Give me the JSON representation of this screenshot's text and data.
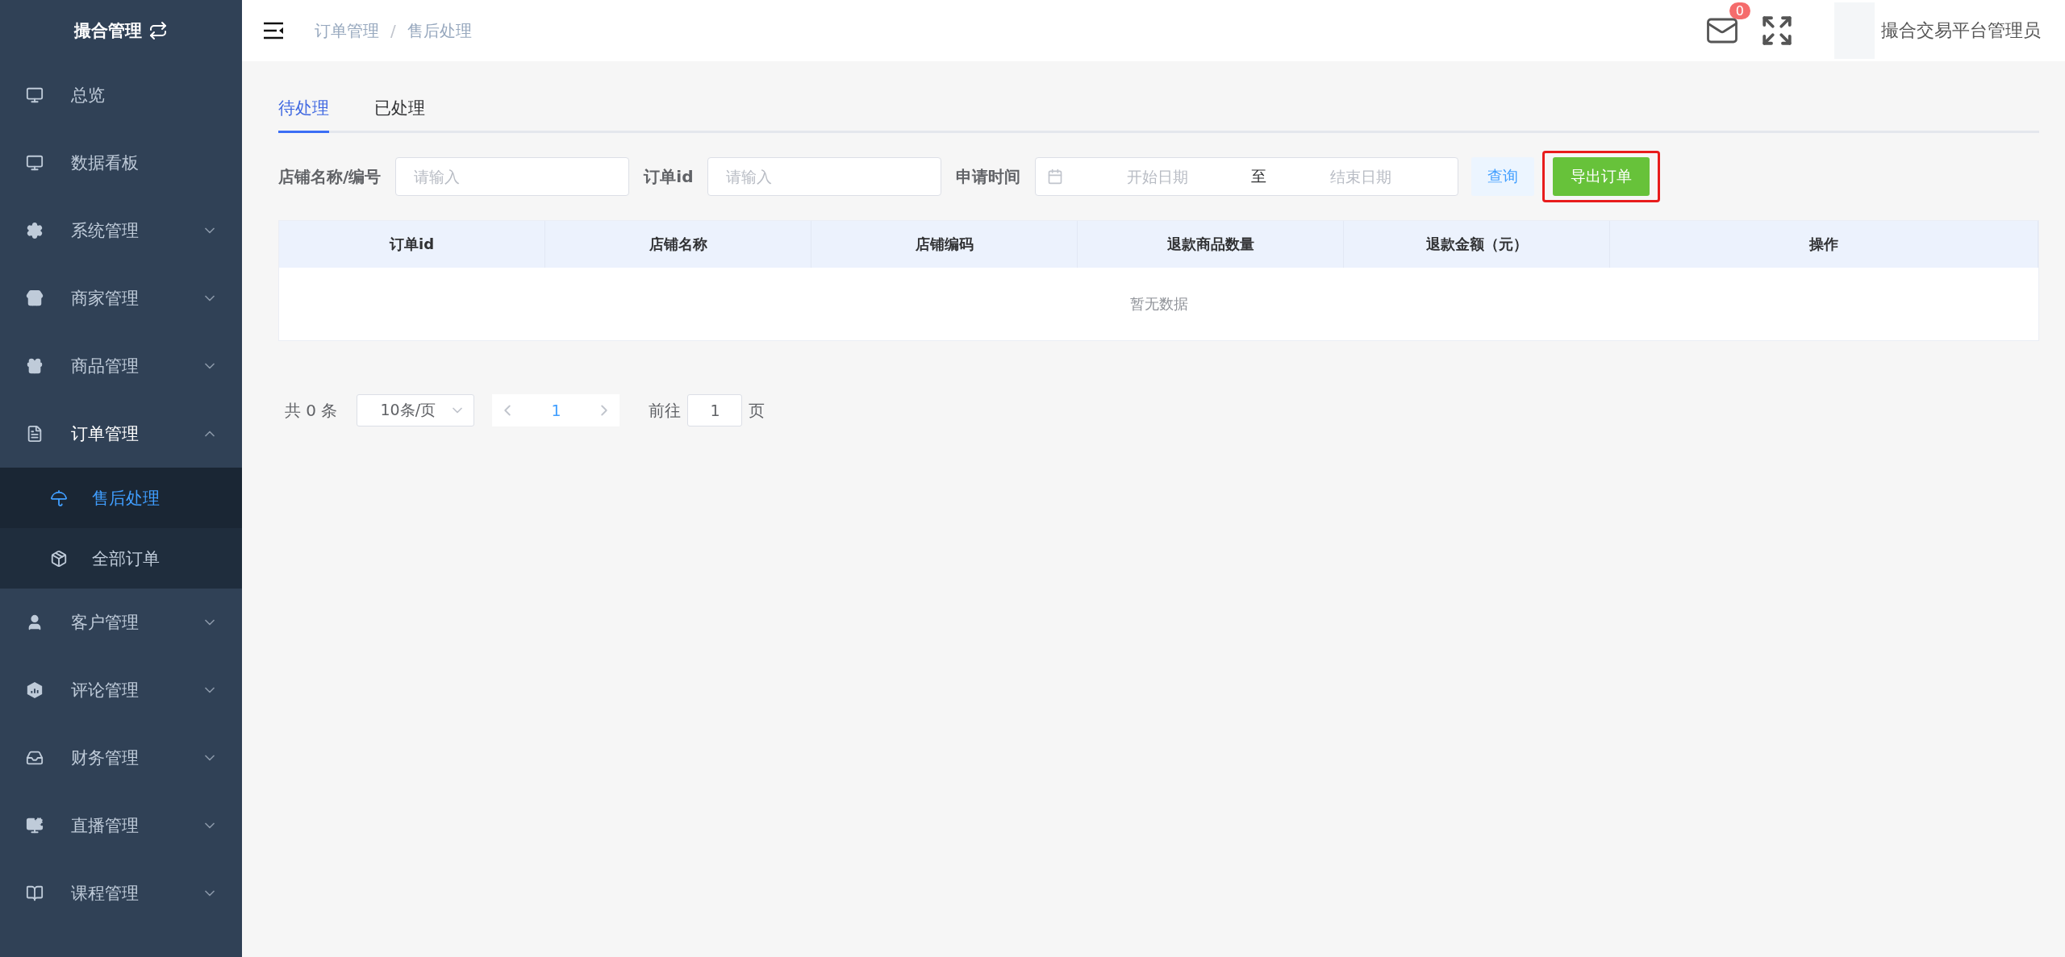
{
  "sidebar": {
    "title": "撮合管理",
    "items": [
      {
        "label": "总览",
        "selected": false
      },
      {
        "label": "数据看板",
        "selected": false
      },
      {
        "label": "系统管理",
        "selected": false,
        "expanded": false
      },
      {
        "label": "商家管理",
        "selected": false,
        "expanded": false
      },
      {
        "label": "商品管理",
        "selected": false,
        "expanded": false
      },
      {
        "label": "订单管理",
        "selected": false,
        "expanded": true,
        "children": [
          {
            "label": "售后处理",
            "selected": true
          },
          {
            "label": "全部订单",
            "selected": false
          }
        ]
      },
      {
        "label": "客户管理",
        "selected": false,
        "expanded": false
      },
      {
        "label": "评论管理",
        "selected": false,
        "expanded": false
      },
      {
        "label": "财务管理",
        "selected": false,
        "expanded": false
      },
      {
        "label": "直播管理",
        "selected": false,
        "expanded": false
      },
      {
        "label": "课程管理",
        "selected": false,
        "expanded": false
      }
    ]
  },
  "header": {
    "breadcrumb": [
      "订单管理",
      "售后处理"
    ],
    "separator": "/",
    "mail_badge": "0",
    "user_name": "撮合交易平台管理员"
  },
  "tabs": [
    {
      "label": "待处理",
      "selected": true
    },
    {
      "label": "已处理",
      "selected": false
    }
  ],
  "filters": {
    "store_label": "店铺名称/编号",
    "store_placeholder": "请输入",
    "order_label": "订单id",
    "order_placeholder": "请输入",
    "date_label": "申请时间",
    "start_placeholder": "开始日期",
    "range_separator": "至",
    "end_placeholder": "结束日期",
    "query_button": "查询",
    "export_button": {
      "label": "导出订单",
      "highlighted": true
    }
  },
  "table": {
    "columns": [
      "订单id",
      "店铺名称",
      "店铺编码",
      "退款商品数量",
      "退款金额（元）",
      "操作"
    ],
    "empty_text": "暂无数据"
  },
  "pagination": {
    "total": "共 0 条",
    "page_size": "10条/页",
    "pages": [
      {
        "label": "1",
        "selected": true
      }
    ],
    "goto_label": "前往",
    "goto_value": "1",
    "goto_suffix": "页"
  }
}
